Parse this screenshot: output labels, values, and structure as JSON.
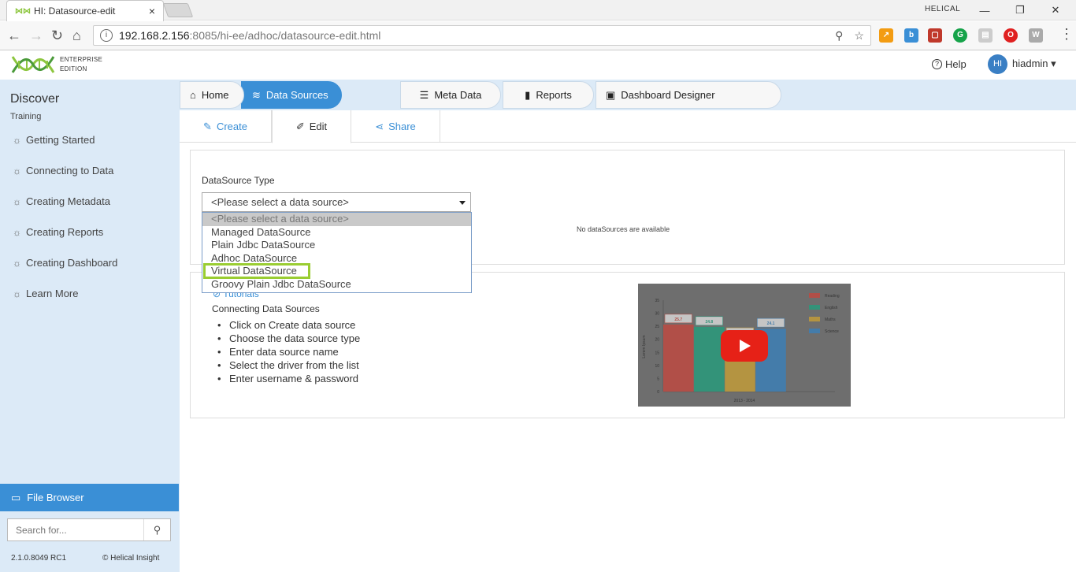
{
  "browser": {
    "tab_title": "HI: Datasource-edit",
    "tab_close": "×",
    "window_label": "HELICAL",
    "url_host": "192.168.2.156",
    "url_rest": ":8085/hi-ee/adhoc/datasource-edit.html",
    "win_min": "—",
    "win_restore": "❐",
    "win_close": "✕"
  },
  "app": {
    "edition_line1": "ENTERPRISE",
    "edition_line2": "EDITION",
    "help_label": "Help",
    "avatar_initials": "HI",
    "username": "hiadmin ▾"
  },
  "sidebar": {
    "title": "Discover",
    "subtitle": "Training",
    "items": [
      {
        "label": "Getting Started"
      },
      {
        "label": "Connecting to Data"
      },
      {
        "label": "Creating Metadata"
      },
      {
        "label": "Creating Reports"
      },
      {
        "label": "Creating Dashboard"
      },
      {
        "label": "Learn More"
      }
    ],
    "file_browser": "File Browser",
    "search_placeholder": "Search for...",
    "version": "2.1.0.8049 RC1",
    "copyright": "© Helical Insight"
  },
  "topnav": {
    "items": [
      {
        "label": "Home",
        "icon": "home-icon"
      },
      {
        "label": "Data Sources",
        "icon": "database-icon",
        "active": true
      },
      {
        "label": "Meta Data",
        "icon": "table-icon"
      },
      {
        "label": "Reports",
        "icon": "bar-chart-icon"
      },
      {
        "label": "Dashboard Designer",
        "icon": "dashboard-icon"
      }
    ]
  },
  "subtabs": {
    "create": "Create",
    "edit": "Edit",
    "share": "Share"
  },
  "datasource": {
    "label": "DataSource Type",
    "selected": "<Please select a data source>",
    "options": [
      "<Please select a data source>",
      "Managed DataSource",
      "Plain Jdbc DataSource",
      "Adhoc DataSource",
      "Virtual DataSource",
      "Groovy Plain Jdbc DataSource"
    ],
    "highlighted_option": "Virtual DataSource",
    "empty_message": "No dataSources are available"
  },
  "tutorials": {
    "link": "Tutorials",
    "heading": "Connecting Data Sources",
    "steps": [
      "Click on Create data source",
      "Choose the data source type",
      "Enter data source name",
      "Select the driver from the list",
      "Enter username & password"
    ]
  },
  "video": {
    "chart_data": {
      "type": "bar",
      "categories": [
        "2013 - 2014"
      ],
      "ylabel": "Lorem Ipsum",
      "ylim": [
        0,
        35
      ],
      "yticks": [
        0,
        5,
        10,
        15,
        20,
        25,
        30,
        35
      ],
      "series": [
        {
          "name": "Reading",
          "values": [
            25.7
          ]
        },
        {
          "name": "English",
          "values": [
            24.8
          ]
        },
        {
          "name": "Maths",
          "values": [
            20.5
          ]
        },
        {
          "name": "Science",
          "values": [
            24.1
          ]
        }
      ],
      "value_labels": [
        "25.7",
        "24.8",
        "20.5",
        "24.1"
      ],
      "colors": [
        "#e04b3f",
        "#1fb38a",
        "#e5b435",
        "#3a8fd6"
      ]
    }
  },
  "colors": {
    "accent": "#3a8fd6",
    "sidebar_bg": "#dceaf7",
    "highlight": "#9acd32"
  }
}
